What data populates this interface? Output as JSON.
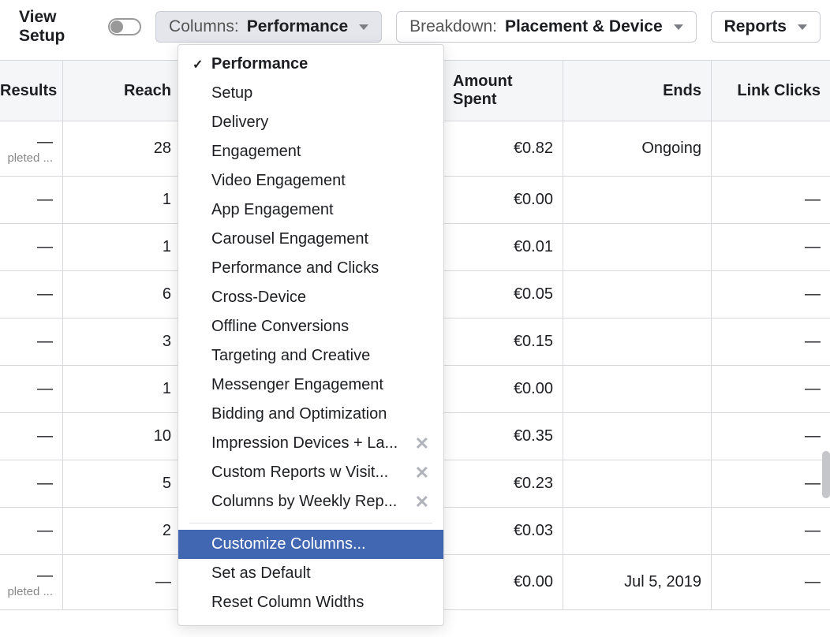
{
  "toolbar": {
    "view_setup_label": "View Setup",
    "columns": {
      "prefix": "Columns:",
      "value": "Performance"
    },
    "breakdown": {
      "prefix": "Breakdown:",
      "value": "Placement & Device"
    },
    "reports_label": "Reports"
  },
  "columns_dropdown": {
    "presets": [
      {
        "label": "Performance",
        "selected": true,
        "removable": false
      },
      {
        "label": "Setup",
        "selected": false,
        "removable": false
      },
      {
        "label": "Delivery",
        "selected": false,
        "removable": false
      },
      {
        "label": "Engagement",
        "selected": false,
        "removable": false
      },
      {
        "label": "Video Engagement",
        "selected": false,
        "removable": false
      },
      {
        "label": "App Engagement",
        "selected": false,
        "removable": false
      },
      {
        "label": "Carousel Engagement",
        "selected": false,
        "removable": false
      },
      {
        "label": "Performance and Clicks",
        "selected": false,
        "removable": false
      },
      {
        "label": "Cross-Device",
        "selected": false,
        "removable": false
      },
      {
        "label": "Offline Conversions",
        "selected": false,
        "removable": false
      },
      {
        "label": "Targeting and Creative",
        "selected": false,
        "removable": false
      },
      {
        "label": "Messenger Engagement",
        "selected": false,
        "removable": false
      },
      {
        "label": "Bidding and Optimization",
        "selected": false,
        "removable": false
      },
      {
        "label": "Impression Devices + La...",
        "selected": false,
        "removable": true
      },
      {
        "label": "Custom Reports w Visit...",
        "selected": false,
        "removable": true
      },
      {
        "label": "Columns by Weekly Rep...",
        "selected": false,
        "removable": true
      }
    ],
    "actions": [
      {
        "label": "Customize Columns...",
        "highlighted": true
      },
      {
        "label": "Set as Default",
        "highlighted": false
      },
      {
        "label": "Reset Column Widths",
        "highlighted": false
      }
    ]
  },
  "table": {
    "headers": {
      "results": "Results",
      "reach": "Reach",
      "amount": "Amount Spent",
      "ends": "Ends",
      "clicks": "Link Clicks"
    },
    "rows": [
      {
        "results": "—",
        "results_sub": "pleted ...",
        "reach": "28",
        "amount": "€0.82",
        "ends": "Ongoing",
        "clicks": "",
        "tall": true
      },
      {
        "results": "—",
        "results_sub": "",
        "reach": "1",
        "amount": "€0.00",
        "ends": "",
        "clicks": "—",
        "tall": false
      },
      {
        "results": "—",
        "results_sub": "",
        "reach": "1",
        "amount": "€0.01",
        "ends": "",
        "clicks": "—",
        "tall": false
      },
      {
        "results": "—",
        "results_sub": "",
        "reach": "6",
        "amount": "€0.05",
        "ends": "",
        "clicks": "—",
        "tall": false
      },
      {
        "results": "—",
        "results_sub": "",
        "reach": "3",
        "amount": "€0.15",
        "ends": "",
        "clicks": "—",
        "tall": false
      },
      {
        "results": "—",
        "results_sub": "",
        "reach": "1",
        "amount": "€0.00",
        "ends": "",
        "clicks": "—",
        "tall": false
      },
      {
        "results": "—",
        "results_sub": "",
        "reach": "10",
        "amount": "€0.35",
        "ends": "",
        "clicks": "—",
        "tall": false
      },
      {
        "results": "—",
        "results_sub": "",
        "reach": "5",
        "amount": "€0.23",
        "ends": "",
        "clicks": "—",
        "tall": false
      },
      {
        "results": "—",
        "results_sub": "",
        "reach": "2",
        "amount": "€0.03",
        "ends": "",
        "clicks": "—",
        "tall": false
      },
      {
        "results": "—",
        "results_sub": "pleted ...",
        "reach": "—",
        "amount": "€0.00",
        "ends": "Jul 5, 2019",
        "clicks": "—",
        "tall": true
      }
    ]
  }
}
